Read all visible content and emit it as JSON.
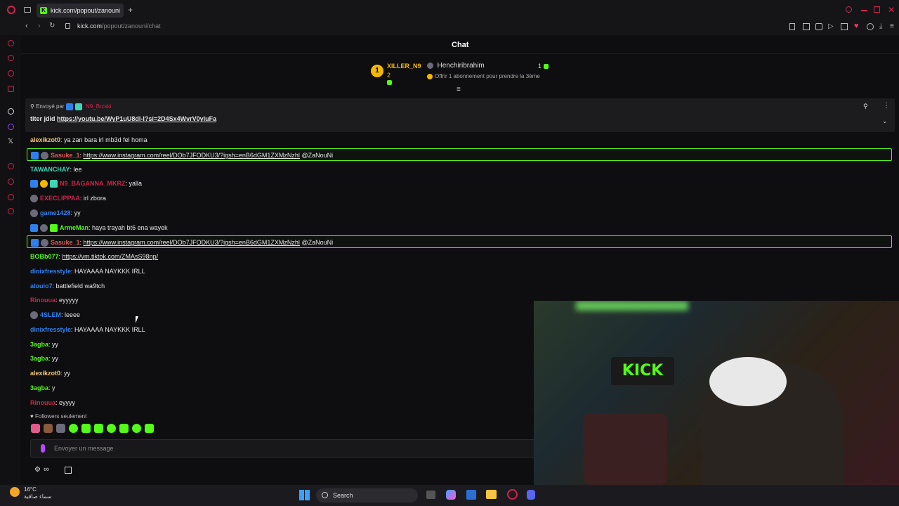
{
  "browser": {
    "tab_title": "kick.com/popout/zanouni",
    "new_tab": "+",
    "url_host": "kick.com",
    "url_path": "/popout/zanouni/chat"
  },
  "chat": {
    "title": "Chat",
    "leaderboard": {
      "rank": "1",
      "top_user": "XILLER_N9",
      "top_count": "2",
      "second_user": "Henchiribrahim",
      "second_count": "1",
      "gift_text": "Offrir 1 abonnement pour prendre la 3ème"
    },
    "pinned": {
      "sent_by_label": "Envoyé par",
      "sender": "N9_Brcski",
      "text_prefix": "titer jdid",
      "link": "https://youtu.be/WyP1uU8dl-I?si=2D4Sx4WvrV0yluFa"
    },
    "messages": [
      {
        "user": "alexikzot0",
        "color": "#f0c674",
        "text": "ya zan bara irl mb3d fel homa",
        "badges": []
      },
      {
        "user": "Sasuke_1",
        "color": "#e05a5a",
        "text": "",
        "link": "https://www.instagram.com/reel/DOb7JFODKU3/?igsh=enB6dGM1ZXMzNzhl",
        "suffix": " @ZaNouNi",
        "badges": [
          "blue",
          "gray"
        ],
        "highlight": true
      },
      {
        "user": "TAWANCHAY",
        "color": "#3fd5b6",
        "text": "lee",
        "badges": []
      },
      {
        "user": "N9_BAGANNA_MKRZ",
        "color": "#d0234a",
        "text": "yalla",
        "badges": [
          "blue",
          "gold",
          "teal"
        ]
      },
      {
        "user": "EXECLIPPAA",
        "color": "#d0234a",
        "text": "irl zbora",
        "badges": [
          "gray"
        ]
      },
      {
        "user": "game1428",
        "color": "#2f80ed",
        "text": "yy",
        "badges": [
          "gray"
        ]
      },
      {
        "user": "ArmeMan",
        "color": "#53fc18",
        "text": "haya trayah bt6 ena wayek",
        "badges": [
          "blue",
          "gray",
          "green"
        ]
      },
      {
        "user": "Sasuke_1",
        "color": "#e05a5a",
        "text": "",
        "link": "https://www.instagram.com/reel/DOb7JFODKU3/?igsh=enB6dGM1ZXMzNzhl",
        "suffix": " @ZaNouNi",
        "badges": [
          "blue",
          "gray"
        ],
        "highlight": true
      },
      {
        "user": "BOBb077",
        "color": "#53fc18",
        "text": "",
        "link": "https://vm.tiktok.com/ZMAsS98np/",
        "suffix": "",
        "badges": []
      },
      {
        "user": "dinixfresstyle",
        "color": "#2f80ed",
        "text": "HAYAAAA NAYKKK IRLL",
        "badges": []
      },
      {
        "user": "alouio7",
        "color": "#2f80ed",
        "text": "battlefield wa9tch",
        "badges": []
      },
      {
        "user": "Rinouua",
        "color": "#d0234a",
        "text": "eyyyyy",
        "badges": []
      },
      {
        "user": "4SLEM",
        "color": "#2f80ed",
        "text": "leeee",
        "badges": [
          "gray"
        ]
      },
      {
        "user": "dinixfresstyle",
        "color": "#2f80ed",
        "text": "HAYAAAA NAYKKK IRLL",
        "badges": []
      },
      {
        "user": "3agba",
        "color": "#53fc18",
        "text": "yy",
        "badges": []
      },
      {
        "user": "3agba",
        "color": "#53fc18",
        "text": "yy",
        "badges": []
      },
      {
        "user": "alexikzot0",
        "color": "#f0c674",
        "text": "yy",
        "badges": []
      },
      {
        "user": "3agba",
        "color": "#53fc18",
        "text": "y",
        "badges": []
      },
      {
        "user": "Rinouua",
        "color": "#d0234a",
        "text": "eyyyy",
        "badges": []
      }
    ],
    "followers_only": "Followers seulement",
    "input_placeholder": "Envoyer un message"
  },
  "taskbar": {
    "temperature": "16°C",
    "weather": "سماء صافية",
    "search": "Search"
  },
  "colors": {
    "accent": "#53fc18",
    "sidebar_icon": "#d0234a",
    "gold": "#f5b800"
  }
}
